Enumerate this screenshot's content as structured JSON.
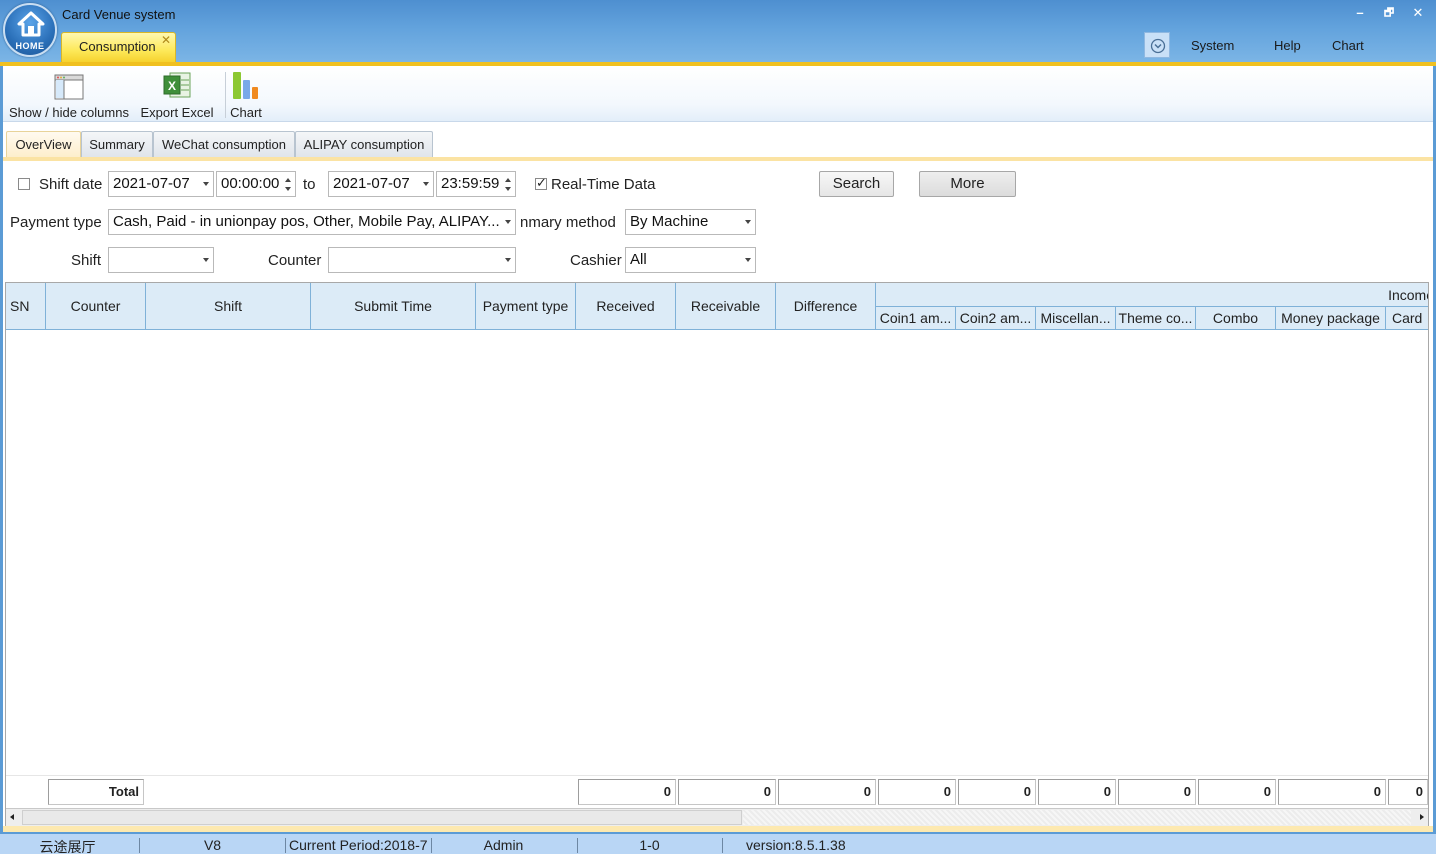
{
  "app": {
    "title": "Card Venue system",
    "home_label": "HOME",
    "open_tab": "Consumption",
    "menu": [
      "System",
      "Help",
      "Chart"
    ],
    "window_controls": {
      "minimize": "–",
      "restore": "🗗",
      "close": "✕"
    }
  },
  "toolbar": {
    "show_hide_columns": "Show / hide columns",
    "export_excel": "Export Excel",
    "chart": "Chart"
  },
  "tabs": [
    {
      "label": "OverView",
      "active": true
    },
    {
      "label": "Summary",
      "active": false
    },
    {
      "label": "WeChat consumption",
      "active": false
    },
    {
      "label": "ALIPAY consumption",
      "active": false
    }
  ],
  "filters": {
    "shift_date_label": "Shift date",
    "shift_date_checked": false,
    "from_date": "2021-07-07",
    "from_time": "00:00:00",
    "to_label": "to",
    "to_date": "2021-07-07",
    "to_time": "23:59:59",
    "realtime_label": "Real-Time Data",
    "realtime_checked": true,
    "search_label": "Search",
    "more_label": "More",
    "payment_type_label": "Payment type",
    "payment_type_value": "Cash, Paid - in unionpay pos, Other, Mobile Pay, ALIPAY...",
    "summary_method_label": "Summary method",
    "summary_method_visible": "nmary method",
    "summary_method_value": "By Machine",
    "shift_label": "Shift",
    "shift_value": "",
    "counter_label": "Counter",
    "counter_value": "",
    "cashier_label": "Cashier",
    "cashier_value": "All"
  },
  "grid": {
    "columns": [
      "SN",
      "Counter",
      "Shift",
      "Submit Time",
      "Payment type",
      "Received",
      "Receivable",
      "Difference"
    ],
    "group_header": "Income",
    "sub_columns": [
      "Coin1 am...",
      "Coin2 am...",
      "Miscellan...",
      "Theme co...",
      "Combo",
      "Money package",
      "Card"
    ],
    "rows": [],
    "total_label": "Total",
    "totals": [
      "0",
      "0",
      "0",
      "0",
      "0",
      "0",
      "0",
      "0",
      "0",
      "0"
    ]
  },
  "status": {
    "venue": "云途展厅",
    "edition": "V8",
    "period": "Current Period:2018-7",
    "user": "Admin",
    "code": "1-0",
    "version": "version:8.5.1.38"
  }
}
